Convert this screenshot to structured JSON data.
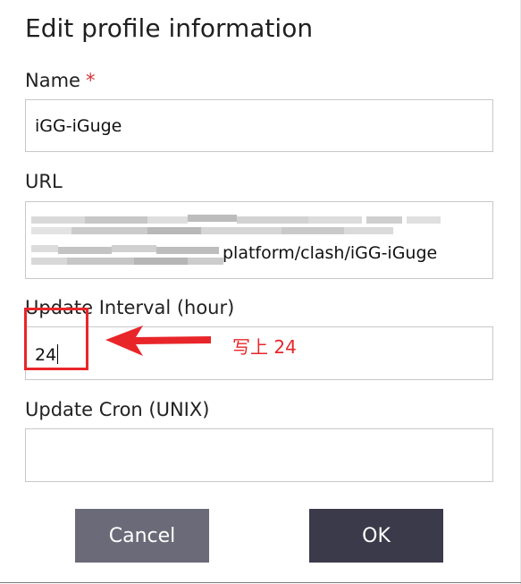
{
  "dialog": {
    "title": "Edit profile information"
  },
  "fields": {
    "name": {
      "label": "Name",
      "required_mark": "*",
      "value": "iGG-iGuge"
    },
    "url": {
      "label": "URL",
      "value_visible_part": "platform/clash/iGG-iGuge"
    },
    "update_interval": {
      "label": "Update Interval (hour)",
      "value": "24"
    },
    "update_cron": {
      "label": "Update Cron (UNIX)",
      "value": ""
    }
  },
  "buttons": {
    "cancel_label": "Cancel",
    "ok_label": "OK"
  },
  "annotation": {
    "text": "写上 24",
    "color": "#e8262a"
  },
  "colors": {
    "required": "#d13438",
    "cancel_bg": "#6b6a78",
    "ok_bg": "#3b3a4a",
    "field_border": "#c8c8c8"
  }
}
